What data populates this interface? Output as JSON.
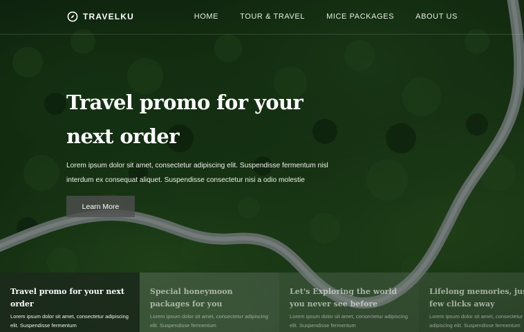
{
  "brand": {
    "name": "TRAVELKU",
    "icon": "compass-icon"
  },
  "nav": {
    "links": [
      "HOME",
      "TOUR & TRAVEL",
      "MICE PACKAGES",
      "ABOUT US"
    ]
  },
  "hero": {
    "headline": "Travel promo for your next order",
    "lead": "Lorem ipsum dolor sit amet, consectetur adipiscing elit. Suspendisse fermentum nisl interdum ex consequat aliquet. Suspendisse consectetur nisi a odio molestie",
    "cta_label": "Learn More"
  },
  "cards": [
    {
      "title": "Travel promo for your next order",
      "text": "Lorem ipsum dolor sit amet, consectetur adipiscing elit. Suspendisse fermentum"
    },
    {
      "title": "Special honeymoon packages for you",
      "text": "Lorem ipsum dolor sit amet, consectetur adipiscing elit. Suspendisse fermentum"
    },
    {
      "title": "Let's Exploring the world you never see before",
      "text": "Lorem ipsum dolor sit amet, consectetur adipiscing elit. Suspendisse fermentum"
    },
    {
      "title": "Lifelong memories, just a few clicks away",
      "text": "Lorem ipsum dolor sit amet, consectetur adipiscing elit. Suspendisse fermentum"
    }
  ]
}
